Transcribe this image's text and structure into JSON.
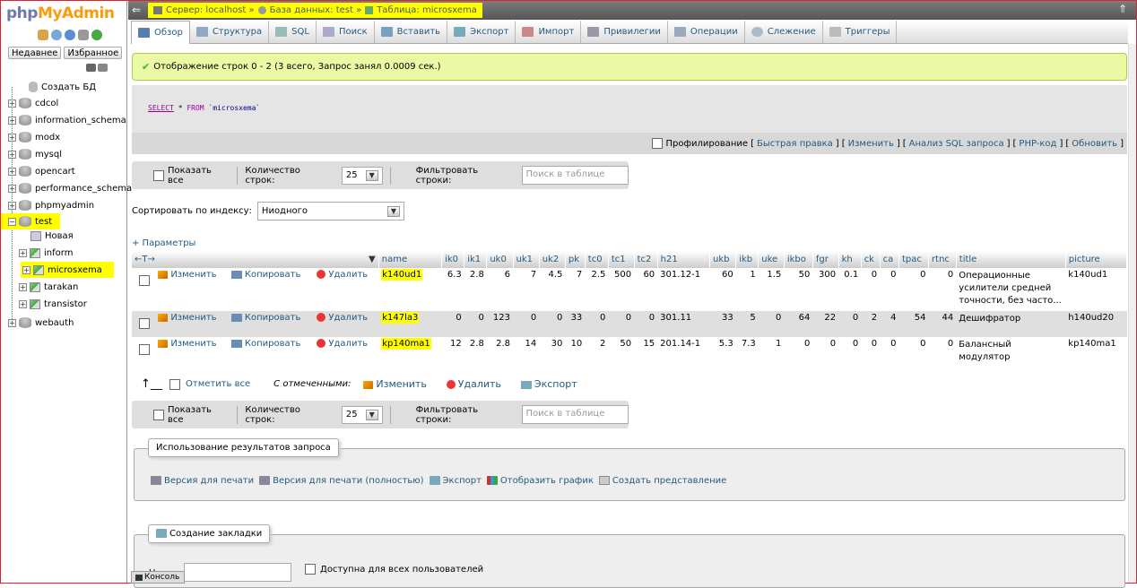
{
  "sidebar": {
    "logo_php": "php",
    "logo_myadmin": "MyAdmin",
    "recent_label": "Недавнее",
    "favorites_label": "Избранное",
    "create_db": "Создать БД",
    "databases": [
      "cdcol",
      "information_schema",
      "modx",
      "mysql",
      "opencart",
      "performance_schema",
      "phpmyadmin",
      "test",
      "webauth"
    ],
    "test_new": "Новая",
    "test_tables": [
      "microsxema",
      "tarakan",
      "transistor"
    ]
  },
  "topbar": {
    "server": "Сервер: localhost »",
    "database": "База данных: test »",
    "table": "Таблица: microsxema"
  },
  "tabs": [
    "Обзор",
    "Структура",
    "SQL",
    "Поиск",
    "Вставить",
    "Экспорт",
    "Импорт",
    "Привилегии",
    "Операции",
    "Слежение",
    "Триггеры"
  ],
  "message": "Отображение строк 0 - 2 (3 всего, Запрос занял 0.0009 сек.)",
  "sql": {
    "select": "SELECT",
    "star": " * ",
    "from": "FROM",
    "table": " `microsxema`"
  },
  "profbar": {
    "profiling": "Профилирование",
    "inline_edit": "Быстрая правка",
    "edit": "Изменить",
    "analyze": "Анализ SQL запроса",
    "php_code": "PHP-код",
    "refresh": "Обновить"
  },
  "nav": {
    "show_all": "Показать все",
    "rows_label": "Количество строк:",
    "rows_value": "25",
    "filter_label": "Фильтровать строки:",
    "filter_placeholder": "Поиск в таблице"
  },
  "sort": {
    "label": "Сортировать по индексу:",
    "value": "Ниодного"
  },
  "options_label": "+ Параметры",
  "table": {
    "columns": [
      "name",
      "ik0",
      "ik1",
      "uk0",
      "uk1",
      "uk2",
      "pk",
      "tc0",
      "tc1",
      "tc2",
      "h21",
      "ukb",
      "ikb",
      "uke",
      "ikbo",
      "fgr",
      "kh",
      "ck",
      "ca",
      "tpac",
      "rtnc",
      "title",
      "picture"
    ],
    "action_edit": "Изменить",
    "action_copy": "Копировать",
    "action_delete": "Удалить",
    "rows": [
      [
        "k140ud1",
        "6.3",
        "2.8",
        "6",
        "7",
        "4.5",
        "7",
        "2.5",
        "500",
        "60",
        "301.12-1",
        "60",
        "1",
        "1.5",
        "50",
        "300",
        "0.1",
        "0",
        "0",
        "0",
        "0",
        "Операционные усилители средней точности, без часто...",
        "k140ud1"
      ],
      [
        "k147la3",
        "0",
        "0",
        "123",
        "0",
        "0",
        "33",
        "0",
        "0",
        "0",
        "301.11",
        "33",
        "5",
        "0",
        "64",
        "22",
        "0",
        "2",
        "4",
        "54",
        "44",
        "Дешифратор",
        "h140ud20"
      ],
      [
        "kp140ma1",
        "12",
        "2.8",
        "2.8",
        "14",
        "30",
        "10",
        "2",
        "50",
        "15",
        "201.14-1",
        "5.3",
        "7.3",
        "1",
        "0",
        "0",
        "0",
        "0",
        "0",
        "0",
        "0",
        "Балансный модулятор",
        "kp140ma1"
      ]
    ]
  },
  "with_selected": {
    "check_all": "Отметить все",
    "label": "С отмеченными:",
    "edit": "Изменить",
    "delete": "Удалить",
    "export": "Экспорт"
  },
  "query_results": {
    "legend": "Использование результатов запроса",
    "print": "Версия для печати",
    "print_full": "Версия для печати (полностью)",
    "export": "Экспорт",
    "chart": "Отобразить график",
    "view": "Создать представление"
  },
  "bookmark": {
    "legend": "Создание закладки",
    "label_fragment": "Н",
    "public": "Доступна для всех пользователей"
  },
  "console": "Консоль"
}
